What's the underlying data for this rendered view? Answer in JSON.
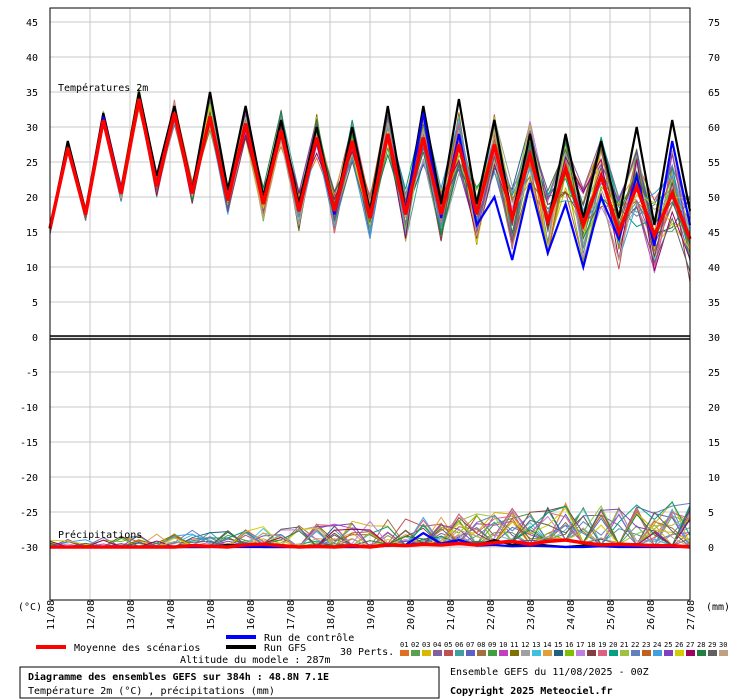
{
  "chart_data": {
    "type": "line",
    "title": "Diagramme des ensembles GEFS sur 384h : 48.8N 7.1E",
    "subtitle": "Température 2m (°C) , précipitations (mm)",
    "panels": {
      "temperature_label": "Températures 2m",
      "precip_label": "Précipitations"
    },
    "left_axis": {
      "unit": "(°C)",
      "ticks": [
        45,
        40,
        35,
        30,
        25,
        20,
        15,
        10,
        5,
        0,
        -5,
        -10,
        -15,
        -20,
        -25,
        -30
      ],
      "range": [
        -38,
        47
      ]
    },
    "right_axis": {
      "unit": "(mm)",
      "ticks": [
        75,
        70,
        65,
        60,
        55,
        50,
        45,
        40,
        35,
        30,
        25,
        20,
        15,
        10,
        5,
        0
      ]
    },
    "x_dates": [
      "11/08",
      "12/08",
      "13/08",
      "14/08",
      "15/08",
      "16/08",
      "17/08",
      "18/08",
      "19/08",
      "20/08",
      "21/08",
      "22/08",
      "23/08",
      "24/08",
      "25/08",
      "26/08",
      "27/08"
    ],
    "grid": true,
    "legend": {
      "mean_label": "Moyenne des scénarios",
      "control_label": "Run de contrôle",
      "gfs_label": "Run GFS",
      "perts_label": "30 Perts.",
      "altitude": "Altitude du modele : 287m",
      "members": [
        "01",
        "02",
        "03",
        "04",
        "05",
        "06",
        "07",
        "08",
        "09",
        "10",
        "11",
        "12",
        "13",
        "14",
        "15",
        "16",
        "17",
        "18",
        "19",
        "20",
        "21",
        "22",
        "23",
        "24",
        "25",
        "26",
        "27",
        "28",
        "29",
        "30"
      ],
      "member_colors": [
        "#e07020",
        "#5aa050",
        "#d8b800",
        "#8060a0",
        "#c05050",
        "#40a0a0",
        "#6060c0",
        "#a07040",
        "#40a040",
        "#c040c0",
        "#807000",
        "#a0a0a0",
        "#40c0e0",
        "#e0a040",
        "#206080",
        "#80c000",
        "#c080e0",
        "#804040",
        "#e06080",
        "#00a080",
        "#a0c040",
        "#6080c0",
        "#c06020",
        "#40a0e0",
        "#8040c0",
        "#d0d000",
        "#a00060",
        "#208040",
        "#606060",
        "#c0a080"
      ]
    },
    "series": [
      {
        "name": "Moyenne des scénarios",
        "color": "#ff0000",
        "temp": [
          15.5,
          27,
          17.5,
          31,
          20.5,
          34,
          21.5,
          32,
          20.5,
          31.5,
          19.5,
          30.5,
          19,
          29.5,
          18,
          28.5,
          18,
          28,
          17,
          29,
          17.5,
          28.5,
          17.5,
          27.5,
          17.5,
          27.5,
          17,
          26,
          16.5,
          24,
          16,
          23,
          15,
          21.5,
          14.5,
          20.5,
          14
        ],
        "precip": [
          0,
          0,
          0,
          0,
          0,
          0,
          0,
          0,
          0.2,
          0.1,
          0,
          0.3,
          0.4,
          0.2,
          0,
          0.1,
          0,
          0.2,
          0,
          0.3,
          0.2,
          0.4,
          0.3,
          0.5,
          0.3,
          0.6,
          0.8,
          0.4,
          0.8,
          1.0,
          0.6,
          0.3,
          0.4,
          0.3,
          0.2,
          0.2,
          0
        ]
      },
      {
        "name": "Run de contrôle",
        "color": "#0000ff",
        "temp": [
          15.5,
          27,
          17.5,
          31.5,
          21,
          34,
          22,
          32,
          21,
          31,
          20,
          30,
          19,
          29,
          18,
          28,
          17.5,
          28,
          17,
          29,
          18,
          32,
          17,
          29,
          16,
          20,
          11,
          22,
          12,
          19,
          10,
          20,
          14,
          23,
          13,
          28,
          16
        ],
        "precip": [
          0,
          0,
          0,
          0,
          0,
          0,
          0,
          0,
          0,
          0,
          0,
          0,
          0,
          0,
          0,
          0,
          0,
          0,
          0,
          0.2,
          0.3,
          2.0,
          0.5,
          1.0,
          0.2,
          0.3,
          0.1,
          0.2,
          0.1,
          0,
          0,
          0.1,
          0,
          0,
          0,
          0,
          0
        ]
      },
      {
        "name": "Run GFS",
        "color": "#000000",
        "temp": [
          15.5,
          28,
          18,
          32,
          21,
          35,
          23,
          33,
          21,
          35,
          21,
          33,
          20,
          31,
          19,
          30,
          18,
          30,
          18,
          33,
          18,
          33,
          19,
          34,
          19,
          31,
          17,
          29,
          16,
          29,
          17,
          28,
          17,
          30,
          16,
          31,
          18
        ],
        "precip": [
          0,
          0,
          0,
          0,
          0,
          0,
          0,
          0,
          0,
          0,
          0.3,
          0.2,
          0,
          0,
          0,
          0,
          0,
          0,
          0,
          0.2,
          0.3,
          0.5,
          0.3,
          1.0,
          0.2,
          1.0,
          0.3,
          0.5,
          0.2,
          0,
          0.2,
          0.3,
          0,
          0.4,
          0,
          0.2,
          0
        ]
      }
    ]
  },
  "footer": {
    "title": "Diagramme des ensembles GEFS sur 384h : 48.8N 7.1E",
    "subtitle": "Température 2m (°C) , précipitations (mm)",
    "ensemble": "Ensemble GEFS du 11/08/2025 - 00Z",
    "copyright": "Copyright 2025 Meteociel.fr"
  }
}
